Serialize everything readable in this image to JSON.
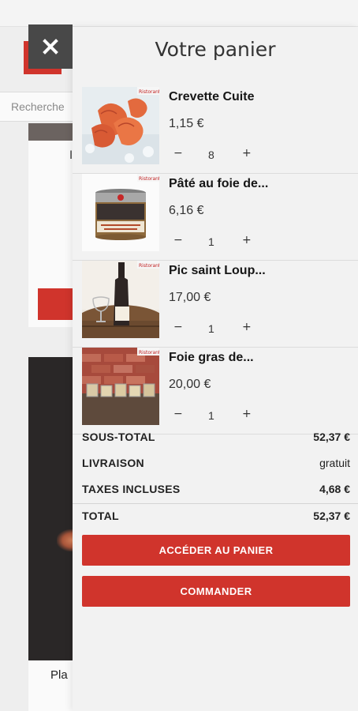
{
  "background": {
    "search_placeholder": "Recherche",
    "card_text": "I",
    "product_partial_title": "Pla"
  },
  "cart": {
    "title": "Votre panier",
    "close_label": "×",
    "items": [
      {
        "name": "Crevette Cuite",
        "price": "1,15 €",
        "quantity": "8",
        "minus": "−",
        "plus": "+",
        "image_icon": "shrimp-image"
      },
      {
        "name": "Pâté au foie de...",
        "price": "6,16 €",
        "quantity": "1",
        "minus": "−",
        "plus": "+",
        "image_icon": "pate-jar-image"
      },
      {
        "name": "Pic saint Loup...",
        "price": "17,00 €",
        "quantity": "1",
        "minus": "−",
        "plus": "+",
        "image_icon": "wine-bottle-image"
      },
      {
        "name": "Foie gras de...",
        "price": "20,00 €",
        "quantity": "1",
        "minus": "−",
        "plus": "+",
        "image_icon": "foie-gras-jars-image"
      }
    ],
    "totals": {
      "subtotal_label": "SOUS-TOTAL",
      "subtotal_value": "52,37 €",
      "shipping_label": "LIVRAISON",
      "shipping_value": "gratuit",
      "taxes_label": "TAXES INCLUSES",
      "taxes_value": "4,68 €",
      "total_label": "TOTAL",
      "total_value": "52,37 €"
    },
    "buttons": {
      "view_cart": "ACCÉDER AU PANIER",
      "checkout": "COMMANDER"
    }
  },
  "colors": {
    "accent": "#d0342c",
    "close_bg": "#484848",
    "drawer_bg": "#f2f2f2"
  }
}
